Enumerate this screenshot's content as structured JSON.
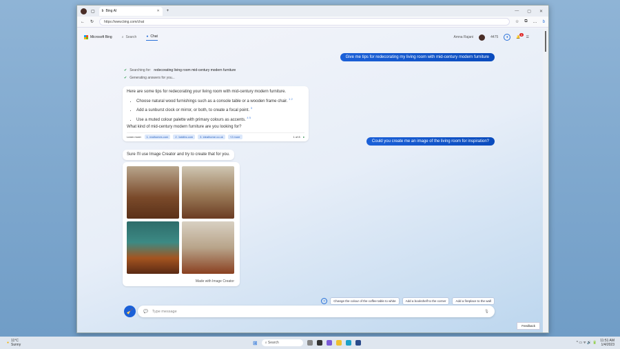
{
  "browser": {
    "tab_title": "Bing AI",
    "url": "https://www.bing.com/chat"
  },
  "header": {
    "brand": "Microsoft Bing",
    "tabs": [
      "Search",
      "Chat"
    ],
    "user": "Amna Rajani",
    "points": "4475",
    "notifications": "3"
  },
  "chat": {
    "user_messages": [
      "Give me tips for redecorating my living room with mid-century modern furniture",
      "Could you create me an image of the living room for inspiration?"
    ],
    "status": [
      {
        "label": "Searching for:",
        "value": "redecorating living room mid-century modern furniture"
      },
      {
        "label": "Generating answers for you...",
        "value": ""
      }
    ],
    "answer": {
      "intro": "Here are some tips for redecorating your living room with mid-century modern furniture.",
      "tips": [
        "Choose natural wood furnishings such as a console table or a wooden frame chair.",
        "Add a sunburst clock or mirror, or both, to create a focal point.",
        "Use a muted colour palette with primary colours as accents."
      ],
      "question": "What kind of mid-century modern furniture are you looking for?",
      "learn_more": "Learn more:",
      "links": [
        "1. realhomes.com",
        "2. 1stdibs.com",
        "3. idealhome.co.uk",
        "+2 more"
      ],
      "counter": "1 of 8"
    },
    "image_reply": "Sure I'll use Image Creator and try to create that for you.",
    "made_with": "Made with Image Creator",
    "suggestions": [
      "Change the colour of the coffee table to white",
      "Add a bookshelf to the corner",
      "Add a fireplace to the wall"
    ],
    "input_placeholder": "Type message",
    "feedback": "Feedback"
  },
  "taskbar": {
    "weather": "11°C",
    "weather_sub": "Sunny",
    "search": "Search",
    "time": "11:51 AM",
    "date": "1/4/2023"
  }
}
